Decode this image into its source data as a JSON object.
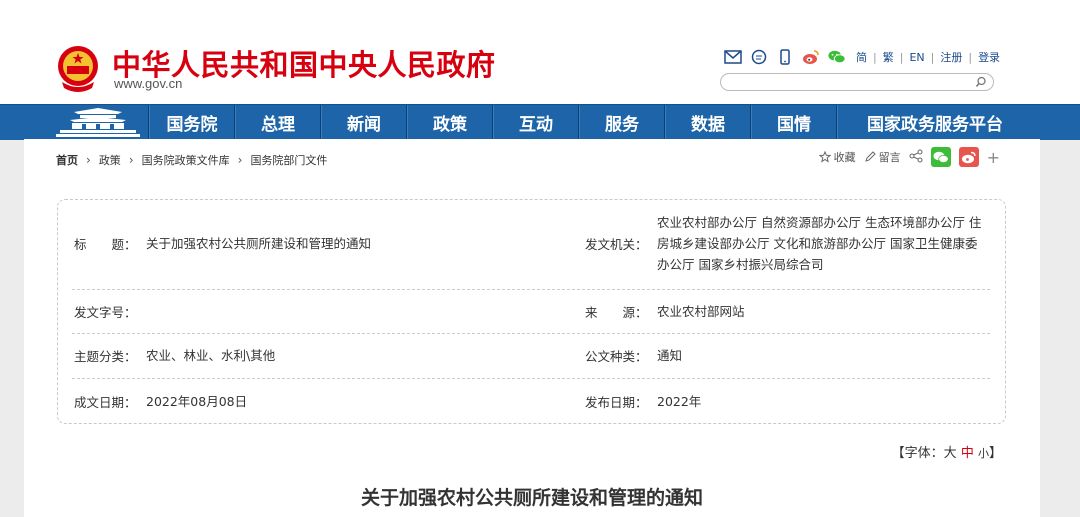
{
  "header": {
    "site_title": "中华人民共和国中央人民政府",
    "site_url": "www.gov.cn",
    "languages": [
      "简",
      "繁",
      "EN"
    ],
    "register": "注册",
    "login": "登录"
  },
  "nav": {
    "items": [
      "国务院",
      "总理",
      "新闻",
      "政策",
      "互动",
      "服务",
      "数据",
      "国情",
      "国家政务服务平台"
    ]
  },
  "breadcrumb": [
    "首页",
    "政策",
    "国务院政策文件库",
    "国务院部门文件"
  ],
  "share": {
    "favorite": "收藏",
    "comment": "留言",
    "more": "+"
  },
  "info": {
    "title_label": "标　　题：",
    "title_value": "关于加强农村公共厕所建设和管理的通知",
    "issuer_label": "发文机关：",
    "issuer_value": "农业农村部办公厅 自然资源部办公厅 生态环境部办公厅 住房城乡建设部办公厅 文化和旅游部办公厅 国家卫生健康委办公厅 国家乡村振兴局综合司",
    "docno_label": "发文字号：",
    "docno_value": "",
    "source_label": "来　　源：",
    "source_value": "农业农村部网站",
    "topic_label": "主题分类：",
    "topic_value": "农业、林业、水利\\其他",
    "type_label": "公文种类：",
    "type_value": "通知",
    "written_label": "成文日期：",
    "written_value": "2022年08月08日",
    "published_label": "发布日期：",
    "published_value": "2022年"
  },
  "font_size": {
    "prefix": "【字体：",
    "large": "大",
    "medium": "中",
    "small": "小",
    "suffix": "】"
  },
  "document": {
    "title": "关于加强农村公共厕所建设和管理的通知"
  },
  "colors": {
    "brand_red": "#d7000f",
    "nav_blue": "#1e64a8",
    "wechat_green": "#3dbc3a",
    "weibo_red": "#e8554e"
  }
}
